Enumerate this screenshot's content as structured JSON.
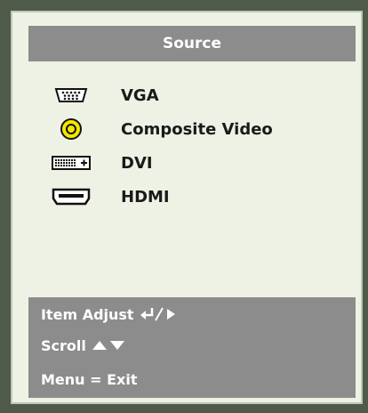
{
  "title": "Source",
  "sources": [
    {
      "label": "VGA",
      "icon": "vga-port-icon"
    },
    {
      "label": "Composite Video",
      "icon": "composite-rca-icon"
    },
    {
      "label": "DVI",
      "icon": "dvi-port-icon"
    },
    {
      "label": "HDMI",
      "icon": "hdmi-port-icon"
    }
  ],
  "help": {
    "item_adjust": "Item Adjust",
    "scroll": "Scroll",
    "menu_exit": "Menu = Exit"
  },
  "colors": {
    "panel_gray": "#8c8c8c",
    "background": "#eef2e4",
    "composite_yellow": "#f2e600"
  }
}
